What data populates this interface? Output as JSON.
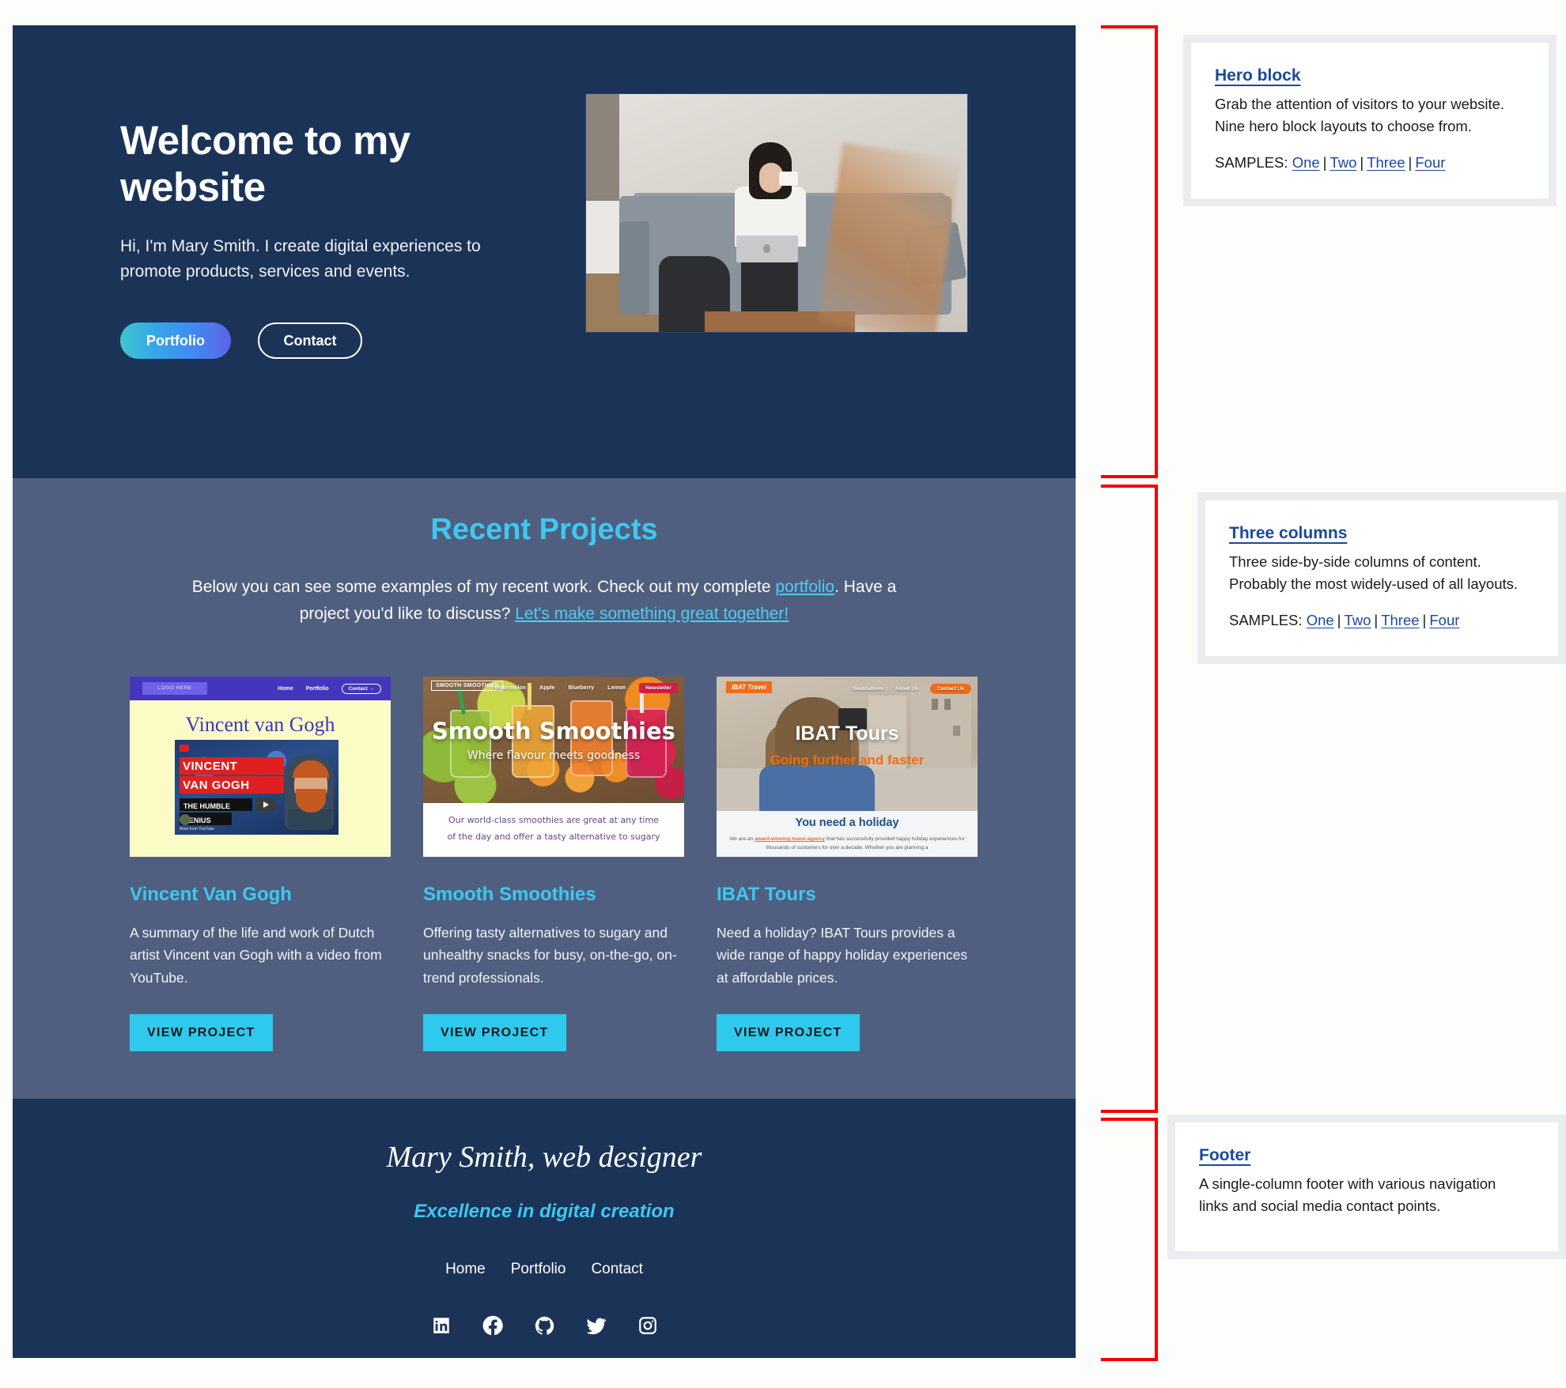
{
  "hero": {
    "title": "Welcome to my website",
    "subtitle": "Hi, I'm Mary Smith. I create digital experiences to promote products, services and events.",
    "primary_button": "Portfolio",
    "secondary_button": "Contact",
    "photo_alt": "woman drinking coffee on couch with laptop",
    "bg_color": "#1b3357"
  },
  "projects": {
    "heading": "Recent Projects",
    "lede_1": "Below you can see some examples of my recent work. Check out my complete ",
    "lede_link_1": "portfolio",
    "lede_2": ". Have a project you'd like to discuss? ",
    "lede_link_2": "Let's make something great together!",
    "bg_color": "#505f7f",
    "accent_color": "#3ec8f0",
    "cards": [
      {
        "title": "Vincent Van Gogh",
        "text": "A summary of the life and work of Dutch artist Vincent van Gogh with a video from YouTube.",
        "button": "VIEW PROJECT",
        "thumb": {
          "logo": "LOGO HERE",
          "nav": [
            "Home",
            "Portfolio"
          ],
          "nav_button": "Contact →",
          "page_title": "Vincent van Gogh",
          "video_line_1": "VINCENT",
          "video_line_2": "VAN GOGH",
          "video_line_3": "THE HUMBLE",
          "video_line_4": "GENIUS",
          "video_more": "More from YouTube"
        }
      },
      {
        "title": "Smooth Smoothies",
        "text": "Offering tasty alternatives to sugary and unhealthy snacks for busy, on-the-go, on-trend professionals.",
        "button": "VIEW PROJECT",
        "thumb": {
          "logo": "SMOOTH SMOOTHIES",
          "nav": [
            "Watermelon",
            "Apple",
            "Blueberry",
            "Lemon"
          ],
          "nav_button": "Newsletter",
          "page_title": "Smooth Smoothies",
          "page_subtitle": "Where flavour meets goodness",
          "body_line_1": "Our world-class smoothies are great at any time",
          "body_line_2": "of the day and offer a tasty alternative to sugary"
        }
      },
      {
        "title": "IBAT Tours",
        "text": "Need a holiday? IBAT Tours provides a wide range of happy holiday experiences at affordable prices.",
        "button": "VIEW PROJECT",
        "thumb": {
          "logo": "IBAT Travel",
          "nav": [
            "Destinations",
            "About Us"
          ],
          "nav_button": "Contact Us",
          "page_title": "IBAT Tours",
          "page_subtitle": "Going further and faster",
          "section_heading": "You need a holiday",
          "body_text_pre": "We are an ",
          "body_text_link": "award-winning travel agency",
          "body_text_post": " that has successfully provided happy holiday experiences for thousands of customers for over a decade. Whether you are planning a"
        }
      }
    ]
  },
  "footer": {
    "name": "Mary Smith, web designer",
    "tagline": "Excellence in digital creation",
    "nav": [
      "Home",
      "Portfolio",
      "Contact"
    ],
    "social": [
      "linkedin-icon",
      "facebook-icon",
      "github-icon",
      "twitter-icon",
      "instagram-icon"
    ],
    "bg_color": "#1b3357",
    "accent_color": "#3ec8f0"
  },
  "annotations": [
    {
      "heading": "Hero block",
      "line_1": "Grab the attention of visitors to your website.",
      "line_2": "Nine hero block layouts to choose from.",
      "samples_label": "SAMPLES:",
      "samples": [
        "One",
        "Two",
        "Three",
        "Four"
      ]
    },
    {
      "heading": "Three columns",
      "line_1": "Three side-by-side columns of content.",
      "line_2": "Probably the most widely-used of all layouts.",
      "samples_label": "SAMPLES:",
      "samples": [
        "One",
        "Two",
        "Three",
        "Four"
      ]
    },
    {
      "heading": "Footer",
      "line_1": "A single-column footer with various navigation",
      "line_2": "links and social media contact points.",
      "samples_label": "",
      "samples": []
    }
  ],
  "annotation_marker_color": "#f40000"
}
